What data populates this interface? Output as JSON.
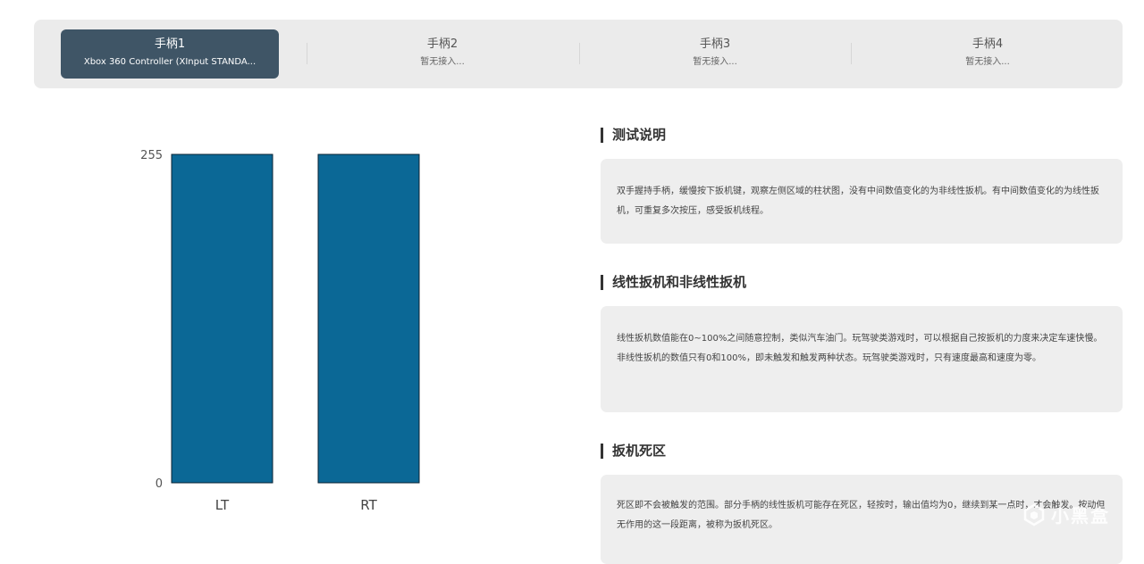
{
  "tabs": [
    {
      "title": "手柄1",
      "subtitle": "Xbox 360 Controller (XInput STANDA..."
    },
    {
      "title": "手柄2",
      "subtitle": "暂无接入..."
    },
    {
      "title": "手柄3",
      "subtitle": "暂无接入..."
    },
    {
      "title": "手柄4",
      "subtitle": "暂无接入..."
    }
  ],
  "chart_data": {
    "type": "bar",
    "categories": [
      "LT",
      "RT"
    ],
    "values": [
      255,
      255
    ],
    "ylim": [
      0,
      255
    ],
    "yticks": [
      0,
      255
    ],
    "bar_color": "#0b6896",
    "title": "",
    "xlabel": "",
    "ylabel": "",
    "grid": false
  },
  "sections": [
    {
      "title": "测试说明",
      "text": "双手握持手柄，缓慢按下扳机键，观察左侧区域的柱状图，没有中间数值变化的为非线性扳机。有中间数值变化的为线性扳机，可重复多次按压，感受扳机线程。"
    },
    {
      "title": "线性扳机和非线性扳机",
      "text": "线性扳机数值能在0~100%之间随意控制，类似汽车油门。玩驾驶类游戏时，可以根据自己按扳机的力度来决定车速快慢。 非线性扳机的数值只有0和100%，即未触发和触发两种状态。玩驾驶类游戏时，只有速度最高和速度为零。"
    },
    {
      "title": "扳机死区",
      "text": "死区即不会被触发的范围。部分手柄的线性扳机可能存在死区，轻按时，输出值均为0，继续到某一点时，才会触发。按动但无作用的这一段距离，被称为扳机死区。"
    }
  ],
  "watermark": {
    "text": "小黑盒"
  },
  "colors": {
    "active_tab": "#3f5566",
    "bar": "#0b6896",
    "card_bg": "#eeeeee"
  }
}
